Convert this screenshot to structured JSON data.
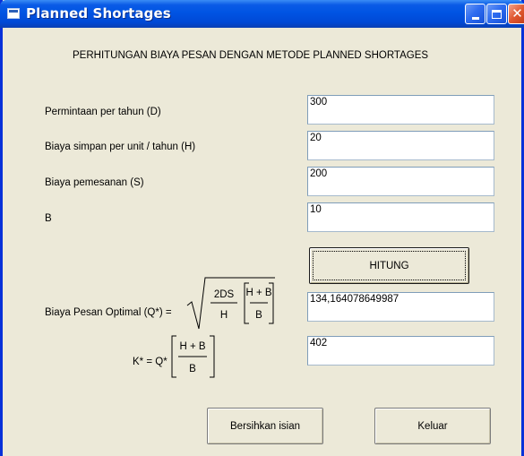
{
  "window": {
    "title": "Planned Shortages"
  },
  "heading": "PERHITUNGAN BIAYA PESAN DENGAN METODE PLANNED SHORTAGES",
  "fields": [
    {
      "label": "Permintaan per tahun (D)",
      "value": "300"
    },
    {
      "label": "Biaya simpan per unit / tahun (H)",
      "value": "20"
    },
    {
      "label": "Biaya pemesanan (S)",
      "value": "200"
    },
    {
      "label": "B",
      "value": "10"
    }
  ],
  "buttons": {
    "hitung": "HITUNG",
    "bersihkan": "Bersihkan isian",
    "keluar": "Keluar"
  },
  "results": {
    "q_label": "Biaya Pesan Optimal (Q*) =",
    "q_num": "2DS",
    "q_den": "H",
    "q_frac_num": "H + B",
    "q_frac_den": "B",
    "q_value": "134,164078649987",
    "k_label": "K* = Q*",
    "k_frac_num": "H + B",
    "k_frac_den": "B",
    "k_value": "402"
  }
}
